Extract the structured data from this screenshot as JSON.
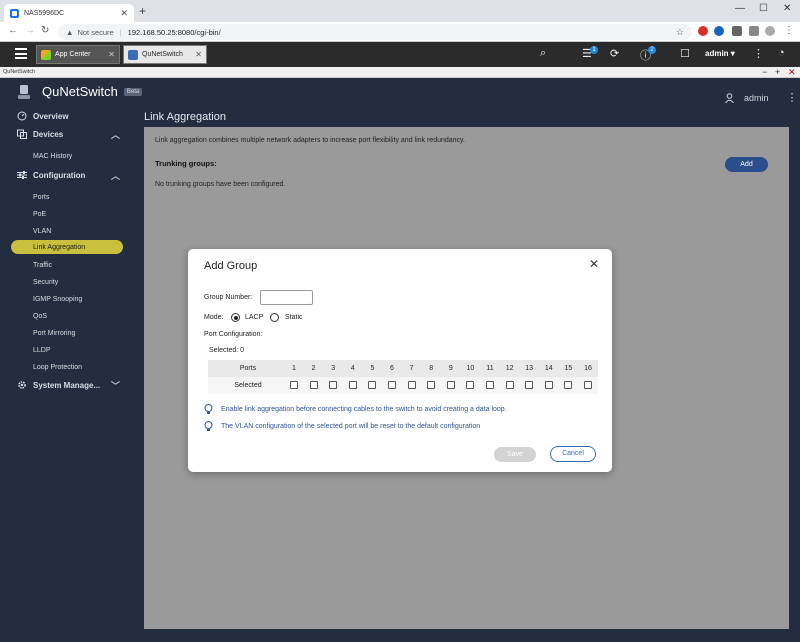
{
  "browser": {
    "tab_title": "NAS5996DC",
    "not_secure": "Not secure",
    "url": "192.168.50.25:8080/cgi-bin/"
  },
  "qts": {
    "tabs": [
      {
        "label": "App Center"
      },
      {
        "label": "QuNetSwitch"
      }
    ],
    "notification_badges": [
      "1",
      "2"
    ],
    "user": "admin ▾"
  },
  "app_window_title": "QuNetSwitch",
  "app": {
    "name": "QuNetSwitch",
    "beta": "Beta",
    "user": "admin"
  },
  "sidebar": {
    "overview": "Overview",
    "devices": "Devices",
    "mac_history": "MAC History",
    "configuration": "Configuration",
    "config_items": [
      "Ports",
      "PoE",
      "VLAN",
      "Link Aggregation",
      "Traffic",
      "Security",
      "IGMP Snooping",
      "QoS",
      "Port Mirroring",
      "LLDP",
      "Loop Protection"
    ],
    "system_management": "System Manage..."
  },
  "page": {
    "title": "Link Aggregation",
    "description": "Link aggregation combines multiple network adapters to increase port flexibility and link redundancy.",
    "trunking_label": "Trunking groups:",
    "no_groups": "No trunking groups have been configured.",
    "add_button": "Add"
  },
  "dialog": {
    "title": "Add Group",
    "group_number_label": "Group Number:",
    "group_number_value": "",
    "mode_label": "Mode:",
    "mode_options": [
      "LACP",
      "Static"
    ],
    "mode_selected": "LACP",
    "port_config_label": "Port Configuration:",
    "selected_count": "Selected: 0",
    "ports_header": "Ports",
    "selected_row_label": "Selected",
    "ports": [
      "1",
      "2",
      "3",
      "4",
      "5",
      "6",
      "7",
      "8",
      "9",
      "10",
      "11",
      "12",
      "13",
      "14",
      "15",
      "16"
    ],
    "notes": [
      "Enable link aggregation before connecting cables to the switch to avoid creating a data loop.",
      "The VLAN configuration of the selected port will be reset to the default configuration"
    ],
    "save": "Save",
    "cancel": "Cancel"
  },
  "colors": {
    "sidebar_bg": "#232d3f",
    "active_item": "#c9c13d",
    "accent_blue": "#2b4d8c"
  }
}
